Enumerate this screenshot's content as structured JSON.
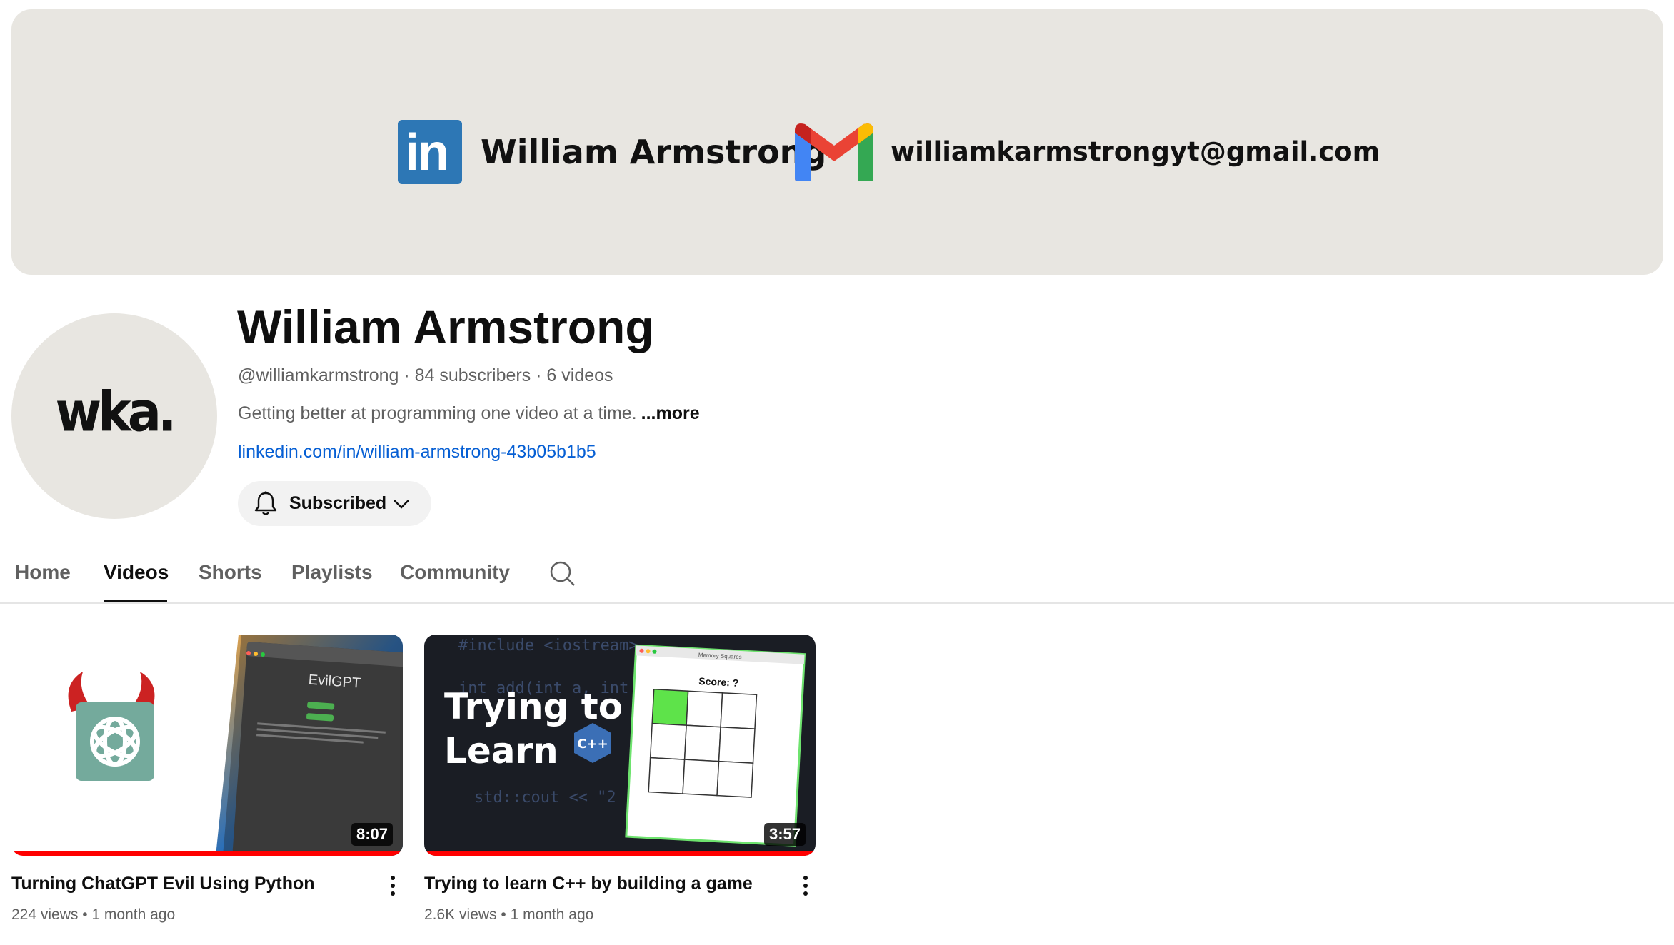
{
  "banner": {
    "name": "William Armstrong",
    "email": "williamkarmstrongyt@gmail.com",
    "linkedin_logo_text": "in"
  },
  "avatar": {
    "text": "wka."
  },
  "channel": {
    "name": "William Armstrong",
    "meta": "@williamkarmstrong · 84 subscribers · 6 videos",
    "description": "Getting better at programming one video at a time.",
    "more_label": "...more",
    "link": "linkedin.com/in/william-armstrong-43b05b1b5",
    "subscribe_label": "Subscribed"
  },
  "tabs": [
    {
      "label": "Home",
      "active": false
    },
    {
      "label": "Videos",
      "active": true
    },
    {
      "label": "Shorts",
      "active": false
    },
    {
      "label": "Playlists",
      "active": false
    },
    {
      "label": "Community",
      "active": false
    }
  ],
  "videos": [
    {
      "title": "Turning ChatGPT Evil Using Python",
      "meta": "224 views • 1 month ago",
      "duration": "8:07",
      "thumb_text": "EvilGPT"
    },
    {
      "title": "Trying to learn C++ by building a game",
      "meta": "2.6K views • 1 month ago",
      "duration": "3:57",
      "thumb_line1": "Trying to",
      "thumb_line2": "Learn",
      "thumb_window_title": "Memory Squares",
      "thumb_score": "Score: ?",
      "thumb_code_1": "#include <iostream>",
      "thumb_code_2": "int add(int a, int b",
      "thumb_code_3": "std::cout << \"2",
      "thumb_cpp": "C++"
    }
  ],
  "colors": {
    "banner_bg": "#e8e6e1",
    "link": "#065fd4",
    "progress": "#ff0000",
    "linkedin": "#2d77b5"
  }
}
